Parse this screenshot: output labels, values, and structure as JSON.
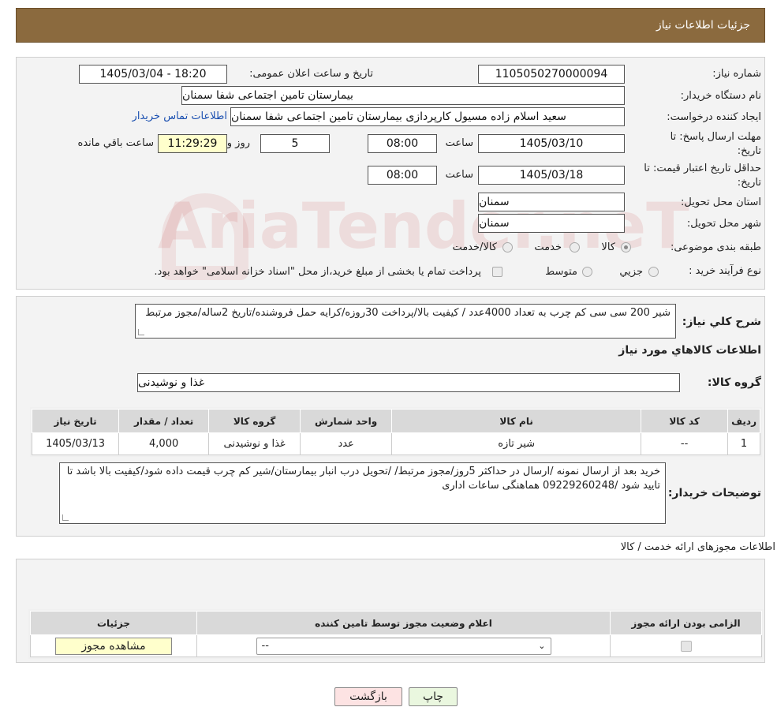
{
  "header_title": "جزئیات اطلاعات نیاز",
  "watermark": "AriaTender.neT",
  "fields": {
    "need_number_label": "شماره نیاز:",
    "need_number": "1105050270000094",
    "announce_label": "تاریخ و ساعت اعلان عمومی:",
    "announce_value": "1405/03/04 - 18:20",
    "buyer_org_label": "نام دستگاه خریدار:",
    "buyer_org": "بیمارستان تامین اجتماعی شفا سمنان",
    "requester_label": "ایجاد کننده درخواست:",
    "requester": "سعید اسلام زاده مسیول کارپردازی بیمارستان تامین اجتماعی شفا سمنان",
    "contact_link": "اطلاعات تماس خریدار",
    "deadline_label_1": "مهلت ارسال پاسخ: تا",
    "deadline_label_2": "تاریخ:",
    "deadline_date": "1405/03/10",
    "time_label": "ساعت",
    "deadline_time": "08:00",
    "days_value": "5",
    "days_label": "روز و",
    "remaining_time": "11:29:29",
    "remaining_label": "ساعت باقي مانده",
    "validity_label_1": "حداقل تاریخ اعتبار قیمت: تا",
    "validity_label_2": "تاریخ:",
    "validity_date": "1405/03/18",
    "validity_time": "08:00",
    "province_label": "استان محل تحویل:",
    "province": "سمنان",
    "city_label": "شهر محل تحویل:",
    "city": "سمنان",
    "category_label": "طبقه بندی موضوعی:",
    "category_options": [
      "کالا",
      "خدمت",
      "کالا/خدمت"
    ],
    "purchase_type_label": "نوع فرآیند خرید :",
    "purchase_options": [
      "جزیي",
      "متوسط"
    ],
    "purchase_note": "پرداخت تمام یا بخشی از مبلغ خرید،از محل \"اسناد خزانه اسلامی\" خواهد بود."
  },
  "summary": {
    "label": "شرح کلي نیاز:",
    "text": "شیر 200 سی سی کم چرب به تعداد 4000عدد / کیفیت بالا/پرداخت 30روزه/کرایه حمل فروشنده/تاریخ 2ساله/مجوز مرتبط"
  },
  "goods_section_title": "اطلاعات کالاهاي مورد نیاز",
  "goods_group_label": "گروه کالا:",
  "goods_group_value": "غذا و نوشیدنی",
  "goods_table": {
    "headers": [
      "ردیف",
      "کد کالا",
      "نام کالا",
      "واحد شمارش",
      "گروه کالا",
      "تعداد / مقدار",
      "تاریخ نیاز"
    ],
    "rows": [
      [
        "1",
        "--",
        "شیر تازه",
        "عدد",
        "غذا و نوشیدنی",
        "4,000",
        "1405/03/13"
      ]
    ]
  },
  "buyer_notes": {
    "label": "توضیحات خریدار:",
    "text": "خرید بعد از ارسال نمونه /ارسال در حداکثر 5روز/مجوز مرتبط/ /تحویل درب انبار بیمارستان/شیر کم چرب قیمت داده شود/کیفیت بالا باشد تا تایید شود   /09229260248 هماهنگی  ساعات اداری"
  },
  "license_section_title": "اطلاعات مجوزهای ارائه خدمت / کالا",
  "license_table": {
    "headers": [
      "الزامی بودن ارائه مجوز",
      "اعلام وضعیت مجوز توسط تامین کننده",
      "جزئیات"
    ],
    "select_value": "--",
    "view_button": "مشاهده مجوز"
  },
  "buttons": {
    "print": "چاپ",
    "back": "بازگشت"
  },
  "colors": {
    "header_bg": "#8b6a3e",
    "panel_bg": "#f3f3f3",
    "remaining_bg": "#ffffcc",
    "back_btn_bg": "#fde3e3",
    "print_btn_bg": "#eaf7df",
    "link": "#1a4fb0"
  }
}
